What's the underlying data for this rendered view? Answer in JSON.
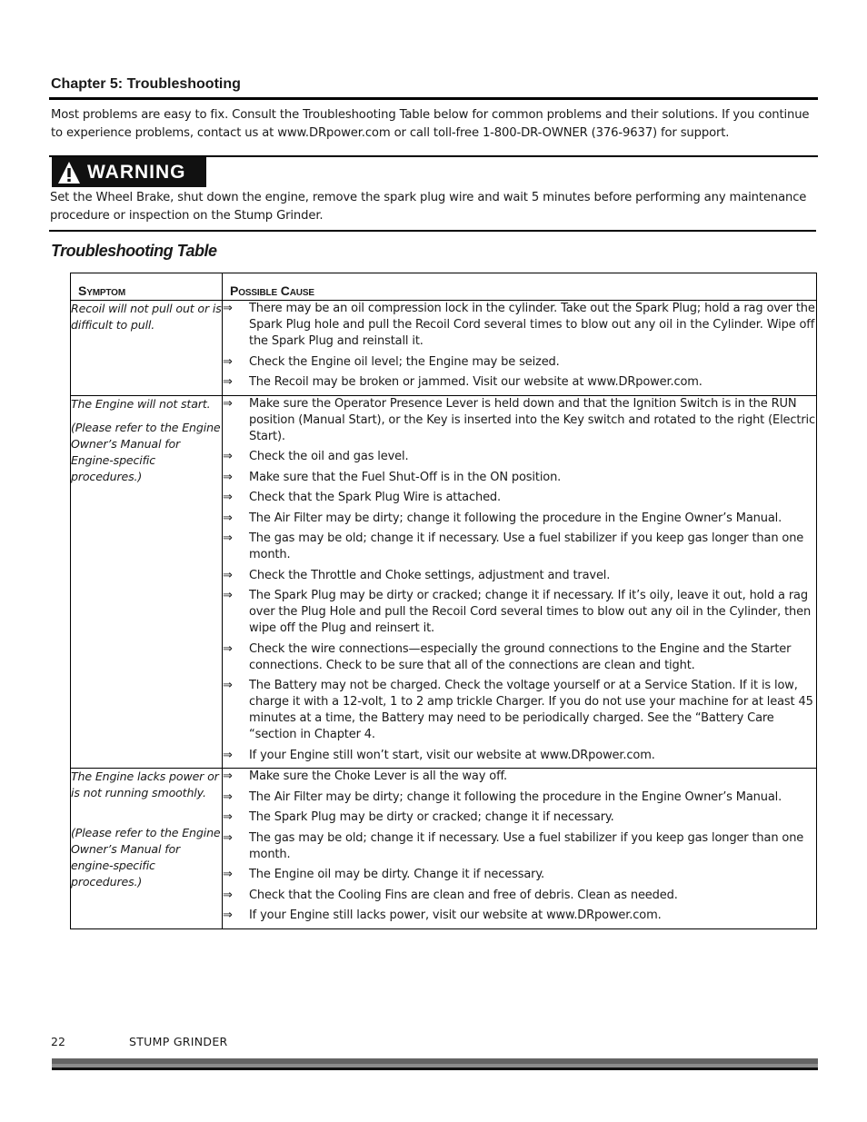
{
  "chapter": {
    "title": "Chapter 5: Troubleshooting",
    "intro": "Most problems are easy to fix. Consult the Troubleshooting Table below for common problems and their solutions. If you continue to experience problems, contact us at www.DRpower.com or call toll-free 1-800-DR-OWNER (376-9637) for support."
  },
  "warning": {
    "icon": "warning-triangle-icon",
    "label": "WARNING",
    "text": "Set the Wheel Brake, shut down the engine, remove the spark plug wire and wait 5 minutes before performing any maintenance procedure or inspection on the Stump Grinder."
  },
  "table": {
    "title": "Troubleshooting Table",
    "bullet": "⇒",
    "headers": {
      "symptom": "Symptom",
      "cause": "Possible Cause"
    },
    "rows": [
      {
        "symptom": [
          "Recoil will not pull out or is difficult to pull."
        ],
        "causes": [
          "There may be an oil compression lock in the cylinder.  Take out the Spark Plug; hold a rag over the Spark Plug hole and pull the Recoil Cord several times to blow out any oil in the Cylinder.  Wipe off the Spark Plug and reinstall it.",
          "Check the Engine oil level; the Engine may be seized.",
          "The Recoil may be broken or jammed.  Visit our website at www.DRpower.com."
        ]
      },
      {
        "symptom": [
          "The Engine will not start.",
          "(Please refer to the Engine Owner’s Manual for Engine-specific procedures.)"
        ],
        "causes": [
          "Make sure the Operator Presence Lever is held down and that the Ignition Switch is in the RUN position (Manual Start), or the Key is inserted into the Key switch and rotated to the right (Electric Start).",
          "Check the oil and gas level.",
          "Make sure that the Fuel Shut-Off is in the ON position.",
          "Check that the Spark Plug Wire is attached.",
          "The Air Filter may be dirty; change it following the procedure in the Engine Owner’s Manual.",
          "The gas may be old; change it if necessary.  Use a fuel stabilizer if you keep gas longer than one month.",
          "Check the Throttle and Choke settings, adjustment and travel.",
          "The Spark Plug may be dirty or cracked; change it if necessary.  If it’s oily, leave it out, hold a rag over the Plug Hole and pull the Recoil Cord several times to blow out any oil in the Cylinder, then wipe off the Plug and reinsert it.",
          "Check the wire connections—especially the ground connections to the Engine and the Starter connections. Check to be sure that all of the connections are clean and tight.",
          "The Battery may not be charged.  Check the voltage yourself or at a Service Station.  If it is low, charge it with a 12-volt, 1 to 2 amp trickle Charger.  If you do not use your machine for at least 45 minutes at a time, the Battery may need to be periodically charged.  See the “Battery Care “section in Chapter 4.",
          "If your Engine still won’t start, visit our website at www.DRpower.com."
        ]
      },
      {
        "symptom": [
          "The Engine lacks power or is not running smoothly.",
          "(Please refer to the Engine Owner’s Manual for engine-specific procedures.)"
        ],
        "causes": [
          "Make sure the Choke Lever is all the way off.",
          "The Air Filter may be dirty; change it following the procedure in the Engine Owner’s Manual.",
          "The Spark Plug may be dirty or cracked; change it if necessary.",
          "The gas may be old; change it if necessary.  Use a fuel stabilizer if you keep gas longer than one month.",
          "The Engine oil may be dirty.  Change it if necessary.",
          "Check that the Cooling Fins are clean and free of debris. Clean as needed.",
          "If your Engine still lacks power, visit our website at www.DRpower.com."
        ]
      }
    ]
  },
  "footer": {
    "page_number": "22",
    "product": "STUMP GRINDER"
  }
}
